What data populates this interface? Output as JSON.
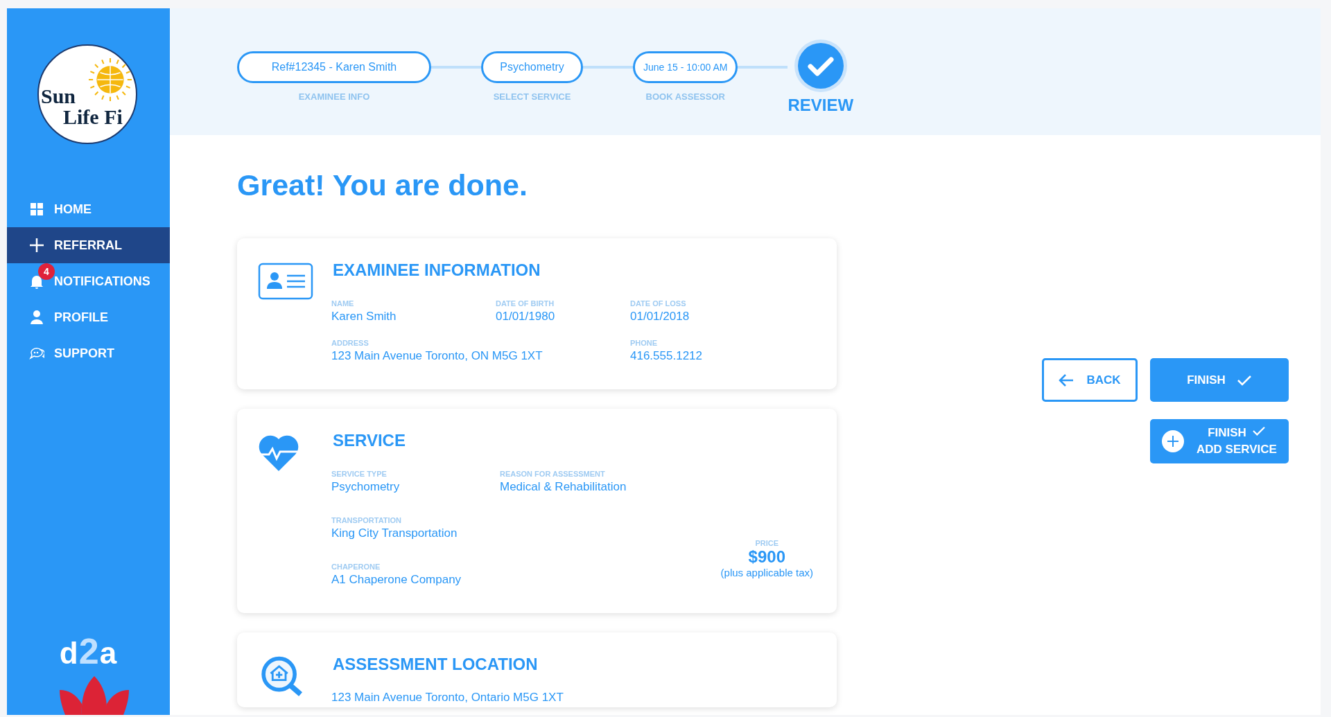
{
  "sidebar": {
    "logo": {
      "lines": [
        "Sun",
        "Life Fi"
      ]
    },
    "nav": [
      {
        "label": "HOME",
        "selected": false
      },
      {
        "label": "REFERRAL",
        "selected": true
      },
      {
        "label": "NOTIFICATIONS",
        "selected": false,
        "badge": "4"
      },
      {
        "label": "PROFILE",
        "selected": false
      },
      {
        "label": "SUPPORT",
        "selected": false
      }
    ],
    "brand": {
      "parts": [
        "d",
        "2",
        "a"
      ]
    }
  },
  "stepper": {
    "steps": [
      {
        "kind": "pill",
        "value": "Ref#12345 -  Karen Smith",
        "label": "EXAMINEE INFO"
      },
      {
        "kind": "pill",
        "value": "Psychometry",
        "label": "SELECT SERVICE"
      },
      {
        "kind": "pill",
        "value": "June 15 - 10:00 AM",
        "label": "BOOK ASSESSOR"
      },
      {
        "kind": "current",
        "label": "REVIEW"
      }
    ]
  },
  "heading": "Great! You are done.",
  "cards": [
    {
      "title": "EXAMINEE INFORMATION",
      "fields": [
        {
          "label": "NAME",
          "value": "Karen Smith"
        },
        {
          "label": "DATE OF BIRTH",
          "value": "01/01/1980"
        },
        {
          "label": "DATE OF LOSS",
          "value": "01/01/2018"
        },
        {
          "label": "ADDRESS",
          "value": "123 Main Avenue Toronto, ON M5G 1XT"
        },
        {
          "label": "PHONE",
          "value": "416.555.1212"
        }
      ]
    },
    {
      "title": "SERVICE",
      "fields": [
        {
          "label": "SERVICE TYPE",
          "value": "Psychometry"
        },
        {
          "label": "REASON FOR ASSESSMENT",
          "value": "Medical & Rehabilitation"
        },
        {
          "label": "TRANSPORTATION",
          "value": "King City Transportation"
        },
        {
          "label": "CHAPERONE",
          "value": "A1 Chaperone Company"
        }
      ],
      "price": {
        "label": "PRICE",
        "amount": "$900",
        "note": "(plus applicable tax)"
      }
    },
    {
      "title": "ASSESSMENT LOCATION",
      "text": "123 Main Avenue Toronto, Ontario M5G 1XT"
    }
  ],
  "actions": [
    {
      "kind": "back",
      "label": "BACK"
    },
    {
      "kind": "finish",
      "label": "FINISH"
    },
    {
      "kind": "finish-add",
      "lines": [
        "FINISH",
        "ADD SERVICE"
      ]
    }
  ]
}
